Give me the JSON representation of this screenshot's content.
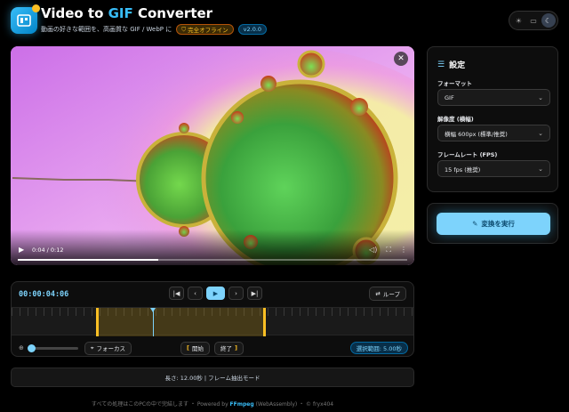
{
  "header": {
    "title_prefix": "Video to ",
    "title_accent": "GIF",
    "title_suffix": " Converter",
    "subtitle": "動画の好きな範囲を、高画質な GIF / WebP に",
    "offline_badge": "完全オフライン",
    "version_badge": "v2.0.0",
    "theme_options": [
      "sun-icon",
      "monitor-icon",
      "moon-icon"
    ],
    "theme_selected": "moon-icon"
  },
  "video": {
    "current_time": "0:04",
    "duration": "0:12",
    "time_display": "0:04 / 0:12",
    "progress_fraction": 0.36
  },
  "timeline": {
    "timecode": "00:00:04:06",
    "loop_label": "ループ",
    "focus_label": "フォーカス",
    "start_label": "開始",
    "end_label": "終了",
    "selection_label": "選択範囲: 5.00秒",
    "zoom_fraction": 0.05,
    "selection_start_fraction": 0.212,
    "selection_end_fraction": 0.627,
    "playhead_fraction": 0.35
  },
  "info_bar": "長さ: 12.00秒 | フレーム抽出モード",
  "footer": {
    "prefix": "すべての処理はこのPCの中で完結します ・ Powered by ",
    "ffmpeg": "FFmpeg",
    "suffix": " (WebAssembly) ・ © fryx404"
  },
  "settings": {
    "heading": "設定",
    "format_label": "フォーマット",
    "format_value": "GIF",
    "resolution_label": "解像度 (横幅)",
    "resolution_value": "横幅 600px (標準/推奨)",
    "fps_label": "フレームレート (FPS)",
    "fps_value": "15 fps (推奨)"
  },
  "convert_button": "変換を実行",
  "colors": {
    "accent": "#7dd3fc",
    "brand_blue": "#38bdf8",
    "selection_yellow": "#fbbf24",
    "background": "#000000"
  }
}
